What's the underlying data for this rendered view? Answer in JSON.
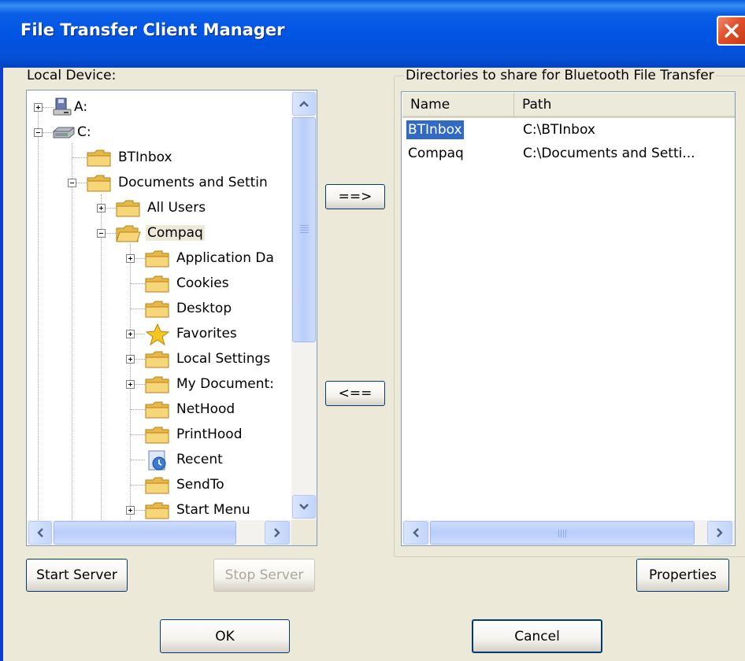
{
  "window": {
    "title": "File Transfer Client  Manager",
    "close_icon": "close-icon",
    "colors": {
      "titlebar": "#0054e3",
      "close": "#e1502b",
      "face": "#ece9d8",
      "selection": "#316ac5"
    }
  },
  "local_device": {
    "label": "Local Device:",
    "tree": [
      {
        "label": "A:",
        "icon": "floppy-drive-icon",
        "expander": "plus"
      },
      {
        "label": "C:",
        "icon": "hard-drive-icon",
        "expander": "minus"
      },
      {
        "label": "BTInbox",
        "icon": "folder-icon",
        "expander": "none"
      },
      {
        "label": "Documents and Settin",
        "icon": "folder-icon",
        "expander": "minus"
      },
      {
        "label": "All Users",
        "icon": "folder-icon",
        "expander": "plus"
      },
      {
        "label": "Compaq",
        "icon": "folder-icon",
        "expander": "minus",
        "selected": true
      },
      {
        "label": "Application Da",
        "icon": "folder-icon",
        "expander": "plus"
      },
      {
        "label": "Cookies",
        "icon": "folder-icon",
        "expander": "none"
      },
      {
        "label": "Desktop",
        "icon": "folder-icon",
        "expander": "none"
      },
      {
        "label": "Favorites",
        "icon": "star-icon",
        "expander": "plus"
      },
      {
        "label": "Local Settings",
        "icon": "folder-icon",
        "expander": "plus"
      },
      {
        "label": "My Document:",
        "icon": "folder-icon",
        "expander": "plus"
      },
      {
        "label": "NetHood",
        "icon": "folder-icon",
        "expander": "none"
      },
      {
        "label": "PrintHood",
        "icon": "folder-icon",
        "expander": "none"
      },
      {
        "label": "Recent",
        "icon": "recent-icon",
        "expander": "none"
      },
      {
        "label": "SendTo",
        "icon": "folder-icon",
        "expander": "none"
      },
      {
        "label": "Start Menu",
        "icon": "folder-icon",
        "expander": "plus"
      }
    ]
  },
  "transfer": {
    "add_label": "==>",
    "remove_label": "<=="
  },
  "shared": {
    "label": "Directories to share for Bluetooth File Transfer",
    "columns": [
      "Name",
      "Path"
    ],
    "rows": [
      {
        "name": "BTInbox",
        "path": "C:\\BTInbox",
        "selected": true
      },
      {
        "name": "Compaq",
        "path": "C:\\Documents and Setti..."
      }
    ]
  },
  "buttons": {
    "start_server": "Start Server",
    "stop_server": "Stop Server",
    "properties": "Properties",
    "ok": "OK",
    "cancel": "Cancel"
  }
}
